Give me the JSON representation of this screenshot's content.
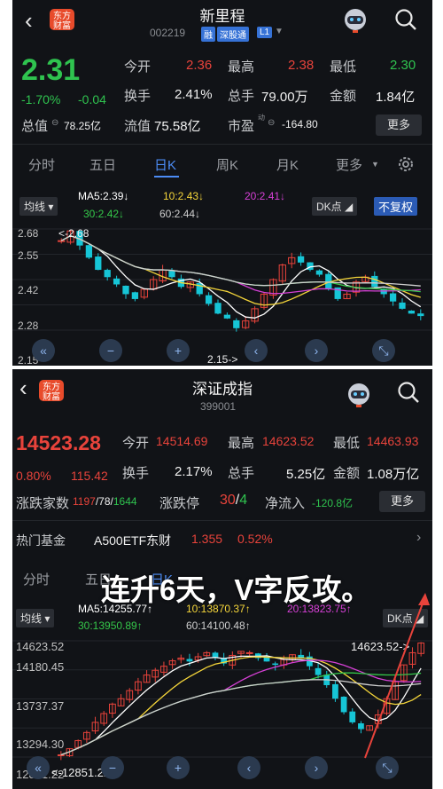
{
  "stock": {
    "name": "新里程",
    "code": "002219",
    "tags": [
      "融",
      "深股通",
      "L1"
    ],
    "price": "2.31",
    "change_pct": "-1.70%",
    "change_amt": "-0.04",
    "open_label": "今开",
    "open": "2.36",
    "high_label": "最高",
    "high": "2.38",
    "low_label": "最低",
    "low": "2.30",
    "turnover_label": "换手",
    "turnover": "2.41%",
    "volume_label": "总手",
    "volume": "79.00万",
    "amount_label": "金额",
    "amount": "1.84亿",
    "mktcap_label": "总值",
    "mktcap": "78.25亿",
    "float_label": "流值",
    "float": "75.58亿",
    "pe_label": "市盈",
    "pe_sup": "动",
    "pe": "-164.80",
    "more": "更多",
    "tabs": [
      "分时",
      "五日",
      "日K",
      "周K",
      "月K",
      "更多"
    ],
    "ma_type": "均线",
    "ma5": "MA5:2.39",
    "ma10": "10:2.43",
    "ma20": "20:2.41",
    "ma30": "30:2.42",
    "ma60": "60:2.44",
    "dk": "DK点",
    "fq": "不复权",
    "price_axis": [
      "2.68",
      "2.55",
      "2.42",
      "2.28",
      "2.15"
    ],
    "max_marker": "2.68",
    "min_marker": "2.15"
  },
  "index": {
    "name": "深证成指",
    "code": "399001",
    "price": "14523.28",
    "change_pct": "0.80%",
    "change_amt": "115.42",
    "open_label": "今开",
    "open": "14514.69",
    "high_label": "最高",
    "high": "14623.52",
    "low_label": "最低",
    "low": "14463.93",
    "turnover_label": "换手",
    "turnover": "2.17%",
    "volume_label": "总手",
    "volume": "5.25亿",
    "amount_label": "金额",
    "amount": "1.08万亿",
    "breadth_label": "涨跌家数",
    "up": "1197",
    "flat": "78",
    "down": "1644",
    "limit_label": "涨跌停",
    "limit_up": "30",
    "limit_down": "4",
    "inflow_label": "净流入",
    "inflow": "-120.8亿",
    "more": "更多",
    "fund_label": "热门基金",
    "fund_name": "A500ETF东财",
    "fund_price": "1.355",
    "fund_pct": "0.52%",
    "tabs": [
      "分时",
      "五日",
      "日K"
    ],
    "ma_type": "均线",
    "ma5": "MA5:14255.77",
    "ma10": "10:13870.37",
    "ma20": "20:13823.75",
    "ma30": "30:13950.89",
    "ma60": "60:14100.48",
    "dk": "DK点",
    "price_axis": [
      "14623.52",
      "14180.45",
      "13737.37",
      "13294.30",
      "12851.22"
    ],
    "max_marker": "14623.52",
    "min_marker": "12851.22",
    "overlay_caption": "连升6天，V字反攻。"
  },
  "colors": {
    "up": "#e8433b",
    "down": "#16c5d6",
    "ma5": "#ffffff",
    "ma10": "#f5d63a",
    "ma20": "#d640d6",
    "ma30": "#35c84a",
    "ma60": "#cfcfcf",
    "accent": "#4c8cf5"
  },
  "icons": [
    "back-icon",
    "robot-avatar-icon",
    "search-icon",
    "gear-icon",
    "dropdown-icon",
    "collapse-left-icon",
    "zoom-out-icon",
    "zoom-in-icon",
    "scroll-left-icon",
    "scroll-right-icon",
    "fullscreen-icon",
    "red-arrow-annotation-icon"
  ]
}
